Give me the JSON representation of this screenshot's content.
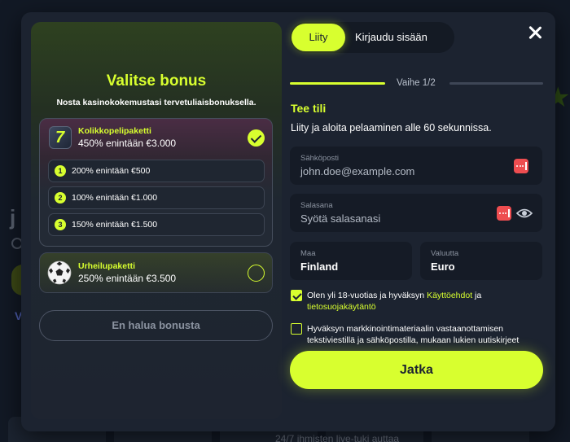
{
  "background": {
    "fragment_letter": "j",
    "fragment_v": "V",
    "bottom_text": "24/7 ihmisten live-tuki auttaa"
  },
  "bonus": {
    "title": "Valitse bonus",
    "subtitle": "Nosta kasinokokemustasi tervetuliaisbonuksella.",
    "casino_package": {
      "name": "Kolikkopelipaketti",
      "amount": "450% enintään €3.000",
      "icon_glyph": "7",
      "selected": true,
      "steps": [
        {
          "num": "1",
          "label": "200% enintään €500"
        },
        {
          "num": "2",
          "label": "100% enintään €1.000"
        },
        {
          "num": "3",
          "label": "150% enintään €1.500"
        }
      ]
    },
    "sport_package": {
      "name": "Urheilupaketti",
      "amount": "250% enintään €3.500",
      "selected": false
    },
    "no_bonus_label": "En halua bonusta"
  },
  "tabs": {
    "register": "Liity",
    "login": "Kirjaudu sisään"
  },
  "progress": {
    "step_label": "Vaihe 1/2",
    "current": 1,
    "total": 2
  },
  "form": {
    "title": "Tee tili",
    "subtitle": "Liity ja aloita pelaaminen alle 60 sekunnissa.",
    "email": {
      "label": "Sähköposti",
      "placeholder": "john.doe@example.com"
    },
    "password": {
      "label": "Salasana",
      "placeholder": "Syötä salasanasi"
    },
    "country": {
      "label": "Maa",
      "value": "Finland"
    },
    "currency": {
      "label": "Valuutta",
      "value": "Euro"
    },
    "terms": {
      "checked": true,
      "text_before": "Olen yli 18-vuotias ja hyväksyn ",
      "link_terms": "Käyttöehdot",
      "text_mid": " ja ",
      "link_privacy": "tietosuojakäytäntö"
    },
    "marketing": {
      "checked": false,
      "text": "Hyväksyn markkinointimateriaalin vastaanottamisen tekstiviestillä ja sähköpostilla, mukaan lukien uutiskirjeet"
    },
    "continue_label": "Jatka"
  },
  "colors": {
    "accent": "#d8ff2f",
    "modal_bg": "#1c2330",
    "field_bg": "#151b26",
    "alert_red": "#ee4d50"
  },
  "icons": {
    "close": "close-icon",
    "slot": "slot-machine-icon",
    "ball": "soccer-ball-icon",
    "password_manager": "password-dots-icon",
    "eye": "eye-icon",
    "check": "check-icon"
  }
}
